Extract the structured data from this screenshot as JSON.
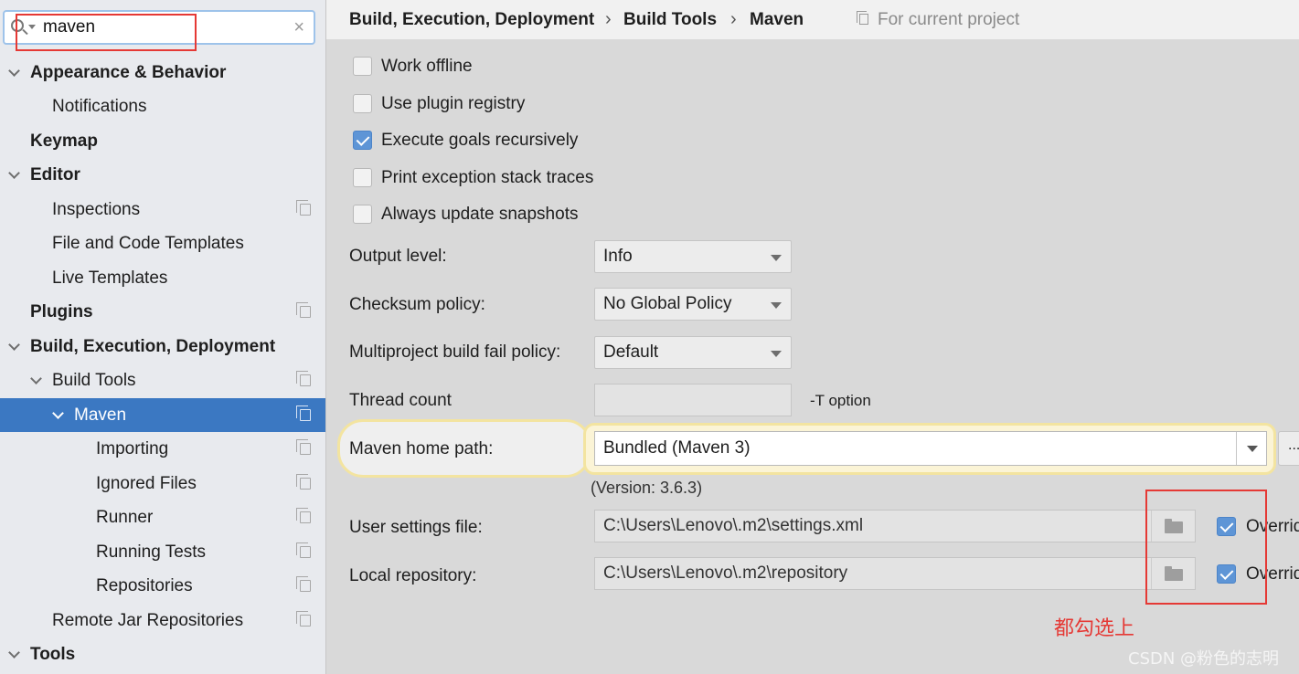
{
  "search": {
    "value": "maven",
    "clear": "×"
  },
  "sidebar": {
    "items": [
      {
        "label": "Appearance & Behavior"
      },
      {
        "label": "Notifications"
      },
      {
        "label": "Keymap"
      },
      {
        "label": "Editor"
      },
      {
        "label": "Inspections"
      },
      {
        "label": "File and Code Templates"
      },
      {
        "label": "Live Templates"
      },
      {
        "label": "Plugins"
      },
      {
        "label": "Build, Execution, Deployment"
      },
      {
        "label": "Build Tools"
      },
      {
        "label": "Maven"
      },
      {
        "label": "Importing"
      },
      {
        "label": "Ignored Files"
      },
      {
        "label": "Runner"
      },
      {
        "label": "Running Tests"
      },
      {
        "label": "Repositories"
      },
      {
        "label": "Remote Jar Repositories"
      },
      {
        "label": "Tools"
      }
    ]
  },
  "header": {
    "breadcrumb": [
      "Build, Execution, Deployment",
      "Build Tools",
      "Maven"
    ],
    "separator": "›",
    "scope": "For current project"
  },
  "options": {
    "work_offline": {
      "label": "Work offline",
      "checked": false
    },
    "plugin_registry": {
      "label": "Use plugin registry",
      "checked": false
    },
    "goals_recursive": {
      "label": "Execute goals recursively",
      "checked": true
    },
    "stack_traces": {
      "label": "Print exception stack traces",
      "checked": false
    },
    "update_snapshots": {
      "label": "Always update snapshots",
      "checked": false
    }
  },
  "fields": {
    "output_level": {
      "label": "Output level:",
      "value": "Info"
    },
    "checksum_policy": {
      "label": "Checksum policy:",
      "value": "No Global Policy"
    },
    "fail_policy": {
      "label": "Multiproject build fail policy:",
      "value": "Default"
    },
    "thread_count": {
      "label": "Thread count",
      "value": "",
      "suffix": "-T option"
    },
    "maven_home": {
      "label": "Maven home path:",
      "value": "Bundled (Maven 3)",
      "more": "...",
      "version": "(Version: 3.6.3)"
    },
    "user_settings": {
      "label": "User settings file:",
      "value": "C:\\Users\\Lenovo\\.m2\\settings.xml",
      "override": "Overrid"
    },
    "local_repo": {
      "label": "Local repository:",
      "value": "C:\\Users\\Lenovo\\.m2\\repository",
      "override": "Overrid"
    }
  },
  "annotation": "都勾选上",
  "watermark": "CSDN @粉色的志明",
  "colors": {
    "selected": "#3b78c2",
    "highlight": "#e53935",
    "checkbox_checked": "#5e95d6"
  }
}
